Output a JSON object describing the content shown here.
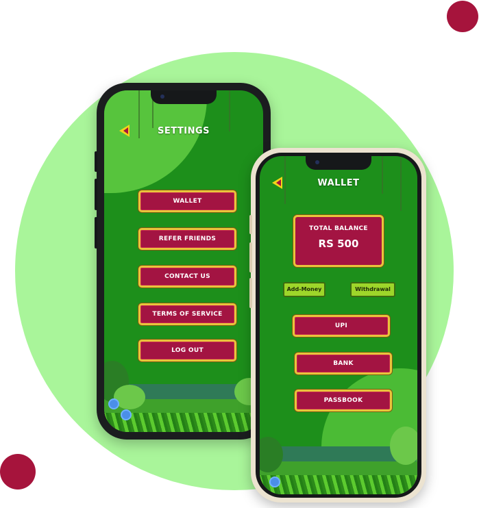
{
  "colors": {
    "accent": "#a6143c",
    "circle": "#a9f59a",
    "screen_green": "#1d8f1b",
    "button_border": "#e8c53b"
  },
  "settings_screen": {
    "title": "SETTINGS",
    "back_icon": "back-arrow-icon",
    "menu": [
      {
        "label": "WALLET"
      },
      {
        "label": "REFER FRIENDS"
      },
      {
        "label": "CONTACT US"
      },
      {
        "label": "TERMS OF SERVICE"
      },
      {
        "label": "LOG OUT"
      }
    ]
  },
  "wallet_screen": {
    "title": "WALLET",
    "back_icon": "back-arrow-icon",
    "balance_label": "TOTAL BALANCE",
    "balance_amount": "RS 500",
    "add_money_label": "Add-Money",
    "withdrawal_label": "Withdrawal",
    "menu": [
      {
        "label": "UPI"
      },
      {
        "label": "BANK"
      },
      {
        "label": "PASSBOOK"
      }
    ]
  }
}
